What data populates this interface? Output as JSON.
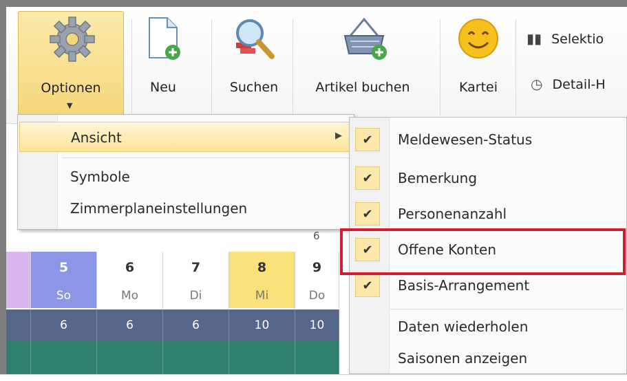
{
  "ribbon": {
    "options_label": "Optionen",
    "new_label": "Neu",
    "search_label": "Suchen",
    "book_item_label": "Artikel buchen",
    "card_index_label": "Kartei",
    "selection_label": "Selektio",
    "detail_label": "Detail-H"
  },
  "options_menu": {
    "view_label": "Ansicht",
    "symbols_label": "Symbole",
    "room_plan_settings_label": "Zimmerplaneinstellungen"
  },
  "view_submenu": {
    "items": [
      {
        "label": "Meldewesen-Status",
        "checked": true
      },
      {
        "label": "Bemerkung",
        "checked": true
      },
      {
        "label": "Personenanzahl",
        "checked": true
      },
      {
        "label": "Offene Konten",
        "checked": true
      },
      {
        "label": "Basis-Arrangement",
        "checked": true
      },
      {
        "label": "Daten wiederholen",
        "checked": false
      },
      {
        "label": "Saisonen anzeigen",
        "checked": false
      }
    ],
    "highlighted": "Offene Konten"
  },
  "calendar": {
    "partial_label": "6",
    "days": [
      {
        "num": "5",
        "name": "So",
        "count": "6"
      },
      {
        "num": "6",
        "name": "Mo",
        "count": "6"
      },
      {
        "num": "7",
        "name": "Di",
        "count": "6"
      },
      {
        "num": "8",
        "name": "Mi",
        "count": "10"
      },
      {
        "num": "9",
        "name": "Do",
        "count": "10"
      }
    ]
  },
  "colors": {
    "accent_yellow": "#f9e27a",
    "highlight_red": "#d0202f",
    "row_blue": "#55668a",
    "row_green": "#2e7f6e",
    "sunday_blue": "#8c96e6"
  }
}
